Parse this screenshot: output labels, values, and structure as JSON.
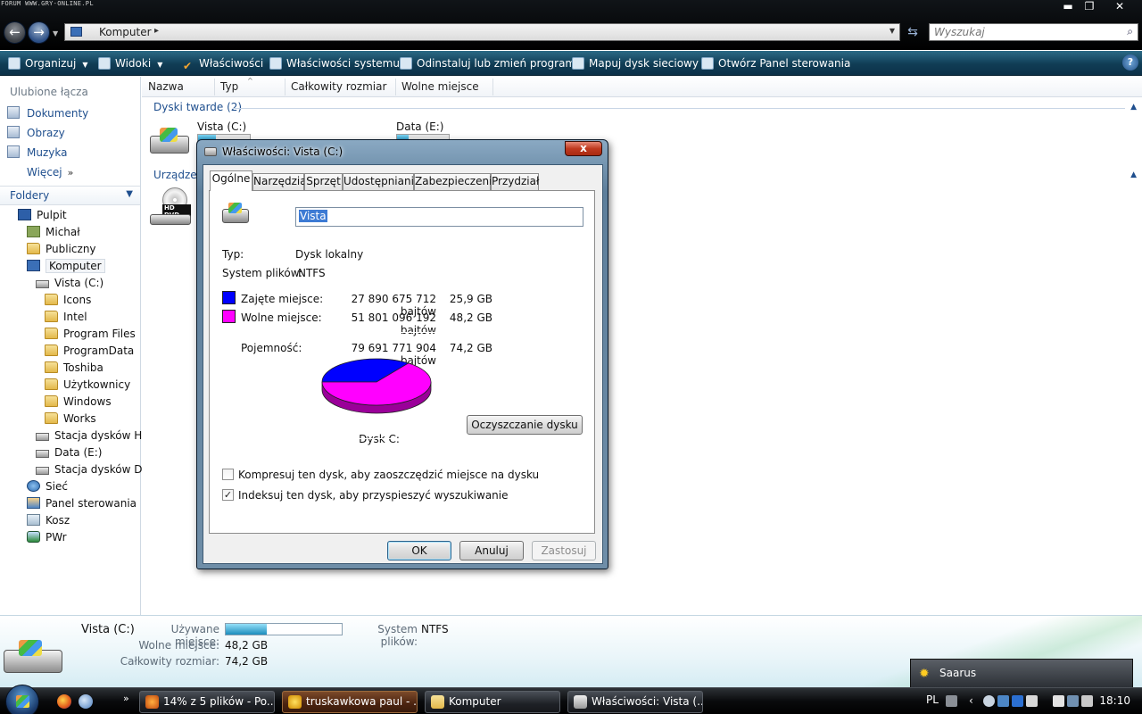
{
  "watermark": "FORUM WWW.GRY-ONLINE.PL",
  "window_controls": {
    "minimize": "▬",
    "maximize": "❐",
    "close": "✕"
  },
  "address_bar": {
    "location": "Komputer",
    "separator": "▸"
  },
  "search": {
    "placeholder": "Wyszukaj"
  },
  "command_bar": {
    "organize": "Organizuj",
    "views": "Widoki",
    "properties": "Właściwości",
    "system_properties": "Właściwości systemu",
    "uninstall": "Odinstaluj lub zmień program",
    "map_drive": "Mapuj dysk sieciowy",
    "control_panel": "Otwórz Panel sterowania",
    "help": "?"
  },
  "favorites": {
    "header": "Ulubione łącza",
    "items": [
      "Dokumenty",
      "Obrazy",
      "Muzyka"
    ],
    "more": "Więcej",
    "more_glyph": "»"
  },
  "folders": {
    "header": "Foldery",
    "tree": [
      "Pulpit",
      "Michał",
      "Publiczny",
      "Komputer",
      "Vista (C:)",
      "Icons",
      "Intel",
      "Program Files",
      "ProgramData",
      "Toshiba",
      "Użytkownicy",
      "Windows",
      "Works",
      "Stacja dysków HD",
      "Data (E:)",
      "Stacja dysków DVI",
      "Sieć",
      "Panel sterowania",
      "Kosz",
      "PWr"
    ]
  },
  "columns": [
    "Nazwa",
    "Typ",
    "Całkowity rozmiar",
    "Wolne miejsce"
  ],
  "groups": {
    "hard_disks": "Dyski twarde (2)",
    "devices_partial": "Urządzen"
  },
  "drives": [
    {
      "label": "Vista (C:)",
      "used_fraction": 0.35
    },
    {
      "label": "Data (E:)",
      "used_fraction": 0.22
    }
  ],
  "hddvd_badge": "HD DVD",
  "details": {
    "name": "Vista (C:)",
    "used_label": "Używane miejsce:",
    "used_fraction": 0.35,
    "fs_label": "System plików:",
    "fs_value": "NTFS",
    "free_label": "Wolne miejsce:",
    "free_value": "48,2 GB",
    "total_label": "Całkowity rozmiar:",
    "total_value": "74,2 GB"
  },
  "gadget": {
    "city": "Saarus"
  },
  "taskbar": {
    "items": [
      "14% z 5 plików - Po...",
      "truskawkowa paul - ...",
      "Komputer",
      "Właściwości: Vista (..."
    ],
    "more": "»",
    "lang": "PL",
    "clock": "18:10"
  },
  "dialog": {
    "title": "Właściwości: Vista (C:)",
    "close": "x",
    "tabs": [
      "Ogólne",
      "Narzędzia",
      "Sprzęt",
      "Udostępnianie",
      "Zabezpieczenia",
      "Przydział"
    ],
    "name_value": "Vista",
    "type_label": "Typ:",
    "type_value": "Dysk lokalny",
    "fs_label": "System plików:",
    "fs_value": "NTFS",
    "used_label": "Zajęte miejsce:",
    "used_bytes": "27 890 675 712 bajtów",
    "used_gb": "25,9 GB",
    "free_label": "Wolne miejsce:",
    "free_bytes": "51 801 096 192 bajtów",
    "free_gb": "48,2 GB",
    "capacity_label": "Pojemność:",
    "capacity_bytes": "79 691 771 904 bajtów",
    "capacity_gb": "74,2 GB",
    "disk_label": "Dysk C:",
    "cleanup_button": "Oczyszczanie dysku",
    "compress_label": "Kompresuj ten dysk, aby zaoszczędzić miejsce na dysku",
    "compress_checked": false,
    "index_label": "Indeksuj ten dysk, aby przyspieszyć wyszukiwanie",
    "index_checked": true,
    "check_glyph": "✓",
    "ok": "OK",
    "cancel": "Anuluj",
    "apply": "Zastosuj"
  },
  "colors": {
    "used": "#0000ff",
    "free": "#ff00ff",
    "used_dark": "#00009a",
    "free_dark": "#9a0099"
  },
  "chart_data": {
    "type": "pie",
    "categories": [
      "Zajęte miejsce",
      "Wolne miejsce"
    ],
    "values": [
      25.9,
      48.2
    ],
    "title": "Dysk C:"
  }
}
